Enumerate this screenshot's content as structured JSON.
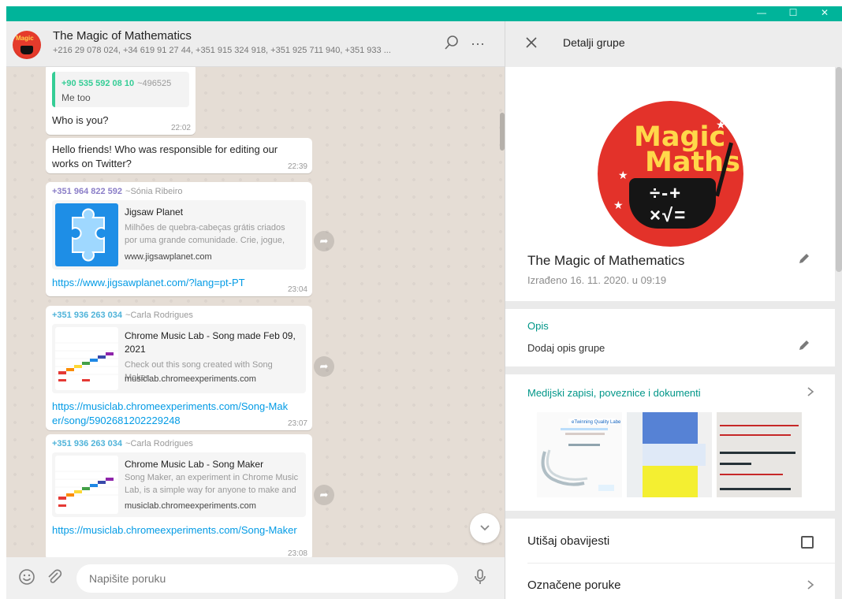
{
  "window": {
    "accent": "#00b49a",
    "controls": [
      "—",
      "☐",
      "✕"
    ]
  },
  "chat": {
    "title": "The Magic of Mathematics",
    "members": "+216 29 078 024, +34 619 91 27 44, +351 915 324 918, +351 925 711 940, +351 933 ...",
    "messages": [
      {
        "quote_phone": "+90 535 592 08 10",
        "quote_nick": "~496525",
        "quote_text": "Me too",
        "text": "Who is you?",
        "time": "22:02"
      },
      {
        "text": "Hello friends! Who was responsible for editing our works on Twitter?",
        "time": "22:39"
      },
      {
        "phone": "+351 964 822 592",
        "nick": "~Sónia Ribeiro",
        "preview_title": "Jigsaw Planet",
        "preview_desc": "Milhões de quebra-cabeças grátis criados por uma grande comunidade. Crie, jogue,",
        "preview_url": "www.jigsawplanet.com",
        "link": "https://www.jigsawplanet.com/?lang=pt-PT",
        "time": "23:04"
      },
      {
        "phone": "+351 936 263 034",
        "nick": "~Carla Rodrigues",
        "preview_title": "Chrome Music Lab - Song made Feb 09, 2021",
        "preview_desc": "Check out this song created with Song Maker.",
        "preview_url": "musiclab.chromeexperiments.com",
        "link": "https://musiclab.chromeexperiments.com/Song-Maker/song/5902681202229248",
        "time": "23:07"
      },
      {
        "phone": "+351 936 263 034",
        "nick": "~Carla Rodrigues",
        "preview_title": "Chrome Music Lab - Song Maker",
        "preview_desc": "Song Maker, an experiment in Chrome Music Lab, is a simple way for anyone to make and",
        "preview_url": "musiclab.chromeexperiments.com",
        "link": "https://musiclab.chromeexperiments.com/Song-Maker",
        "time": "23:08"
      }
    ],
    "compose_placeholder": "Napišite poruku"
  },
  "panel": {
    "title": "Detalji grupe",
    "group_name": "The Magic of Mathematics",
    "created": "Izrađeno 16. 11. 2020. u 09:19",
    "avatar_line1": "Magic",
    "avatar_line2": "Maths",
    "avatar_hat": "÷-+ ×√=",
    "description_label": "Opis",
    "description_placeholder": "Dodaj opis grupe",
    "media_label": "Medijski zapisi, poveznice i dokumenti",
    "mute_label": "Utišaj obavijesti",
    "starred_label": "Označene poruke"
  }
}
